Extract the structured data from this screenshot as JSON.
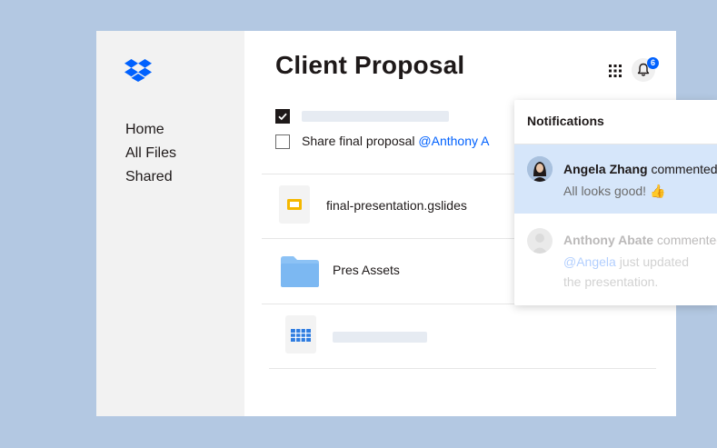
{
  "app": {
    "accent_color": "#0061fe",
    "logo_icon": "dropbox-logo-icon"
  },
  "sidebar": {
    "items": [
      {
        "label": "Home"
      },
      {
        "label": "All Files"
      },
      {
        "label": "Shared"
      }
    ]
  },
  "header": {
    "title": "Client Proposal",
    "apps_icon": "grid-icon",
    "notifications_icon": "bell-icon",
    "notification_count": "6"
  },
  "tasks": [
    {
      "checked": true,
      "text": ""
    },
    {
      "checked": false,
      "text": "Share final proposal ",
      "mention": "@Anthony A"
    }
  ],
  "files": [
    {
      "name": "final-presentation.gslides",
      "icon": "slides-file-icon"
    },
    {
      "name": "Pres Assets",
      "icon": "folder-icon"
    },
    {
      "name": "",
      "icon": "sheet-file-icon"
    }
  ],
  "notifications": {
    "title": "Notifications",
    "items": [
      {
        "name": "Angela Zhang",
        "action": " commented",
        "message": "All looks good! 👍",
        "active": true
      },
      {
        "name": "Anthony Abate",
        "action": " commented",
        "mention": "@Angela",
        "message": " just updated",
        "message2": "the presentation.",
        "active": false
      }
    ]
  }
}
